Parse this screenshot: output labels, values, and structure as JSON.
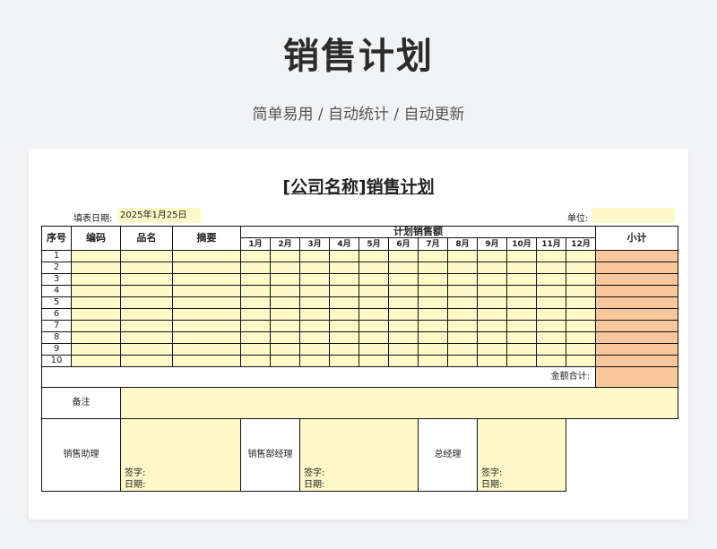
{
  "hero": {
    "title": "销售计划",
    "subtitle": "简单易用 / 自动统计 / 自动更新"
  },
  "document": {
    "title": "[公司名称]销售计划",
    "date_label": "填表日期:",
    "date_value": "2025年1月25日",
    "unit_label": "单位:",
    "unit_value": ""
  },
  "table": {
    "headers": {
      "index": "序号",
      "code": "编码",
      "product": "品名",
      "summary": "摘要",
      "plan": "计划销售额",
      "subtotal": "小计"
    },
    "months": [
      "1月",
      "2月",
      "3月",
      "4月",
      "5月",
      "6月",
      "7月",
      "8月",
      "9月",
      "10月",
      "11月",
      "12月"
    ],
    "rows": [
      "1",
      "2",
      "3",
      "4",
      "5",
      "6",
      "7",
      "8",
      "9",
      "10"
    ],
    "total_label": "金额合计:",
    "note_label": "备注",
    "signers": [
      {
        "role": "销售助理",
        "sign": "签字:",
        "date": "日期:"
      },
      {
        "role": "销售部经理",
        "sign": "签字:",
        "date": "日期:"
      },
      {
        "role": "总经理",
        "sign": "签字:",
        "date": "日期:"
      }
    ]
  },
  "colors": {
    "input_fill": "#fdf9c9",
    "subtotal_fill": "#f9c79b",
    "background": "#f2f3f5"
  }
}
